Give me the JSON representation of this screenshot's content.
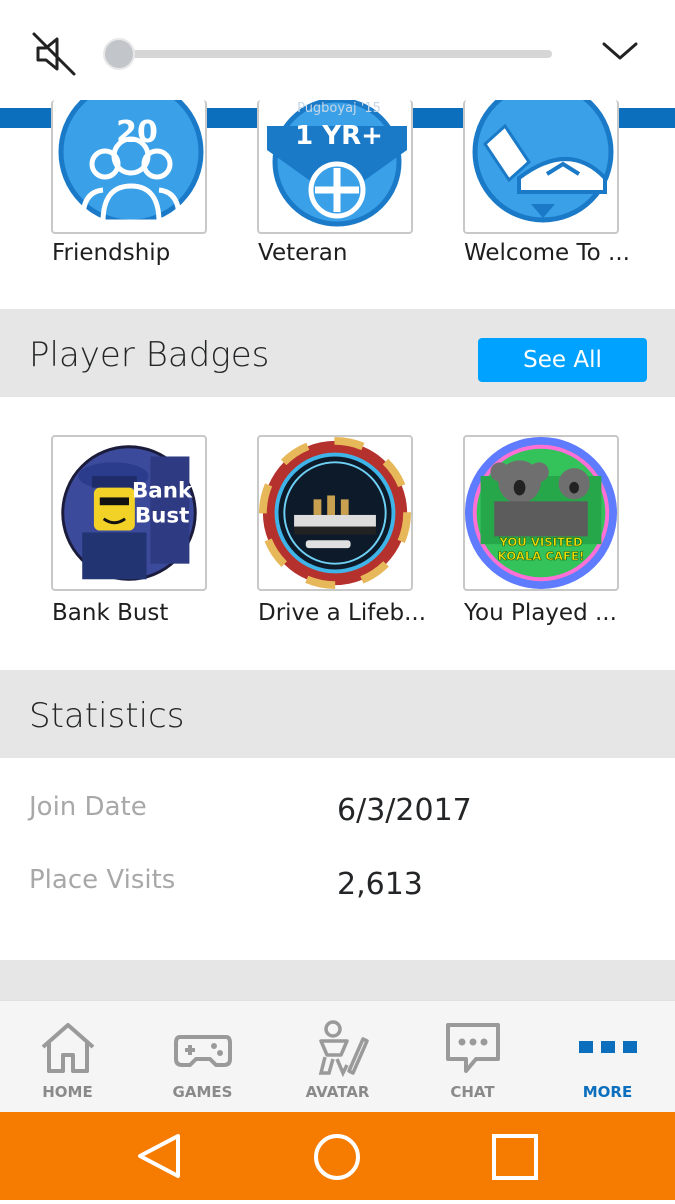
{
  "media": {
    "volume_level": 0.0,
    "icons": {
      "mute": "volume-muted-icon",
      "collapse": "chevron-down-icon"
    }
  },
  "game_badges": {
    "items": [
      {
        "label": "Friendship",
        "icon": "friendship-badge-icon",
        "overlay_text": "20"
      },
      {
        "label": "Veteran",
        "icon": "veteran-badge-icon",
        "overlay_text": "1 YR+",
        "caption": "Pugboyaj '15"
      },
      {
        "label": "Welcome To ...",
        "icon": "welcome-badge-icon"
      }
    ]
  },
  "player_badges": {
    "title": "Player Badges",
    "see_all_label": "See All",
    "items": [
      {
        "label": "Bank Bust",
        "icon": "bank-bust-badge-icon",
        "badge_text_line1": "Bank",
        "badge_text_line2": "Bust"
      },
      {
        "label": "Drive a Lifeb...",
        "icon": "lifeboat-badge-icon"
      },
      {
        "label": "You Played ...",
        "icon": "koala-cafe-badge-icon",
        "badge_text_line1": "YOU VISITED",
        "badge_text_line2": "KOALA CAFE!"
      }
    ]
  },
  "statistics": {
    "title": "Statistics",
    "rows": [
      {
        "label": "Join Date",
        "value": "6/3/2017"
      },
      {
        "label": "Place Visits",
        "value": "2,613"
      }
    ]
  },
  "bottom_nav": {
    "items": [
      {
        "label": "HOME",
        "icon": "home-icon"
      },
      {
        "label": "GAMES",
        "icon": "gamepad-icon"
      },
      {
        "label": "AVATAR",
        "icon": "avatar-icon"
      },
      {
        "label": "CHAT",
        "icon": "chat-icon"
      },
      {
        "label": "MORE",
        "icon": "more-icon",
        "active": true
      }
    ]
  },
  "colors": {
    "brand_blue": "#0b6fbe",
    "button_blue": "#00a2ff",
    "android_nav": "#f57c00",
    "section_bg": "#e6e6e6"
  }
}
